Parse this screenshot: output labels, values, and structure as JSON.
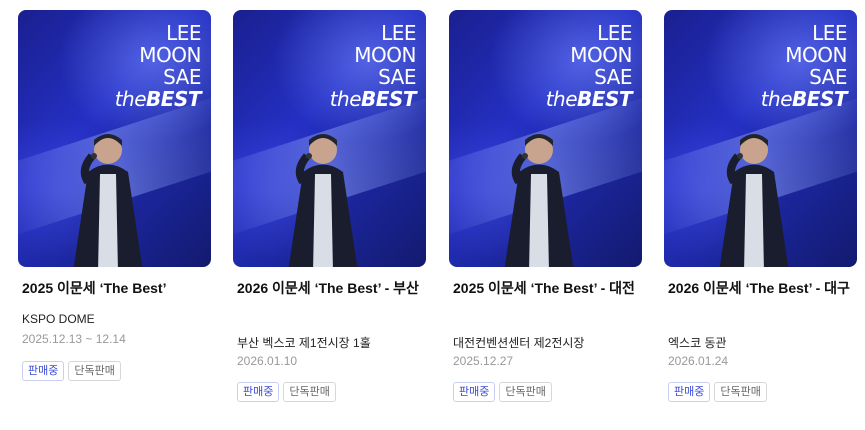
{
  "logo": {
    "line1": "LEE",
    "line2": "MOON",
    "line3": "SAE",
    "line4_prefix": "the",
    "line4_main": "BEST"
  },
  "cards": [
    {
      "title": "2025 이문세 ‘The Best’",
      "venue": "KSPO DOME",
      "date": "2025.12.13 ~ 12.14",
      "tag1": "판매중",
      "tag2": "단독판매"
    },
    {
      "title": "2026 이문세 ‘The Best’ - 부산",
      "venue": "부산 벡스코 제1전시장 1홀",
      "date": "2026.01.10",
      "tag1": "판매중",
      "tag2": "단독판매"
    },
    {
      "title": "2025 이문세 ‘The Best’ - 대전",
      "venue": "대전컨벤션센터 제2전시장",
      "date": "2025.12.27",
      "tag1": "판매중",
      "tag2": "단독판매"
    },
    {
      "title": "2026 이문세 ‘The Best’ - 대구",
      "venue": "엑스코 동관",
      "date": "2026.01.24",
      "tag1": "판매중",
      "tag2": "단독판매"
    }
  ]
}
